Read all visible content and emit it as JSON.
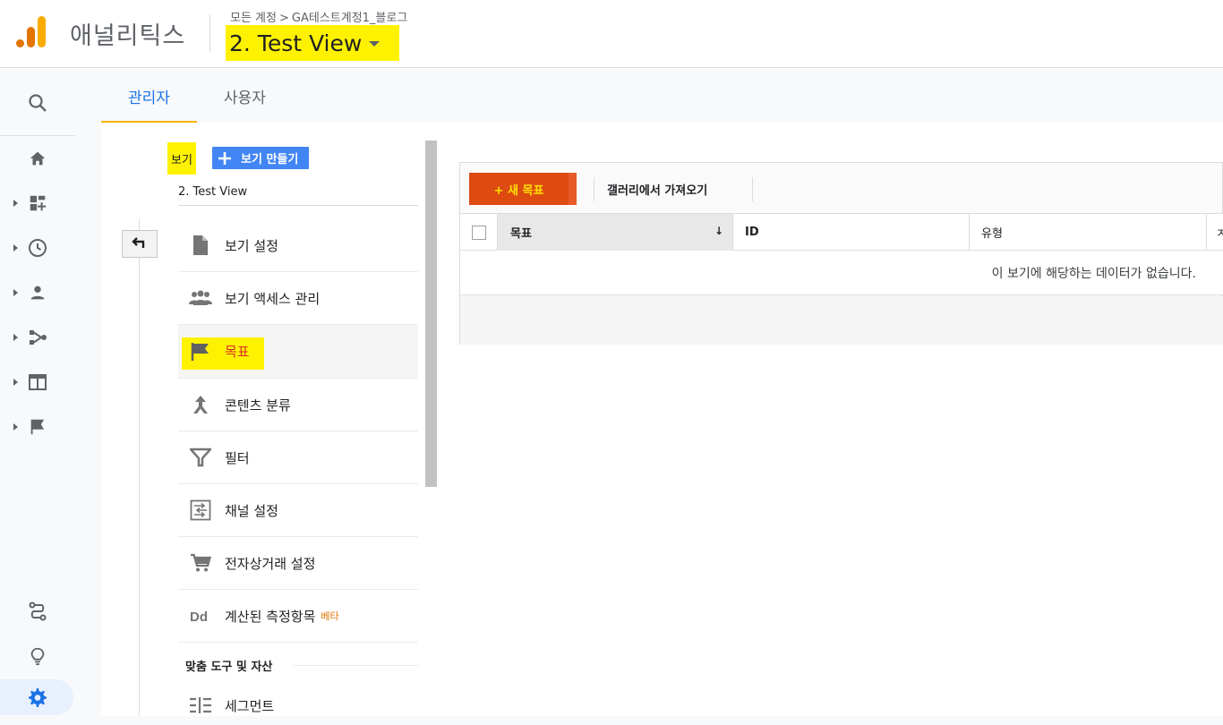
{
  "header": {
    "app_title": "애널리틱스",
    "breadcrumb": [
      "모든 계정",
      "GA테스트계정1_블로그"
    ],
    "breadcrumb_sep": ">",
    "view_name": "2. Test View",
    "logo_colors": [
      "#e37400",
      "#f9ab00"
    ]
  },
  "rail": {
    "items": [
      {
        "icon": "search-icon"
      },
      {
        "icon": "home-icon"
      },
      {
        "icon": "customization-icon"
      },
      {
        "icon": "realtime-clock-icon"
      },
      {
        "icon": "audience-person-icon"
      },
      {
        "icon": "acquisition-icon"
      },
      {
        "icon": "behavior-icon"
      },
      {
        "icon": "conversions-flag-icon"
      },
      {
        "icon": "attribution-icon"
      },
      {
        "icon": "discover-lightbulb-icon"
      },
      {
        "icon": "admin-gear-icon"
      }
    ]
  },
  "tabs": [
    "관리자",
    "사용자"
  ],
  "view_column": {
    "label": "보기",
    "create_button": "보기 만들기",
    "current_view": "2. Test View",
    "menu": [
      {
        "label": "보기 설정",
        "icon": "document-icon"
      },
      {
        "label": "보기 액세스 관리",
        "icon": "people-icon"
      },
      {
        "label": "목표",
        "icon": "flag-icon"
      },
      {
        "label": "콘텐츠 분류",
        "icon": "merge-icon"
      },
      {
        "label": "필터",
        "icon": "filter-icon"
      },
      {
        "label": "채널 설정",
        "icon": "channel-settings-icon"
      },
      {
        "label": "전자상거래 설정",
        "icon": "cart-icon"
      },
      {
        "label": "계산된 측정항목",
        "icon": "dd-icon",
        "badge": "베타"
      }
    ],
    "section_header": "맞춤 도구 및 자산",
    "segment_item": {
      "label": "세그먼트",
      "icon": "segments-icon"
    }
  },
  "goals_panel": {
    "new_goal_button": "+ 새 목표",
    "gallery_button": "갤러리에서 가져오기",
    "columns": [
      "목표",
      "ID",
      "유형",
      "ㅈ"
    ],
    "sort_indicator": "↓",
    "empty_message": "이 보기에 해당하는 데이터가 없습니다."
  },
  "colors": {
    "accent": "#1a73e8",
    "highlight": "#fff200",
    "new_goal_bg": "#dd4b10",
    "create_view_bg": "#4285f4"
  }
}
